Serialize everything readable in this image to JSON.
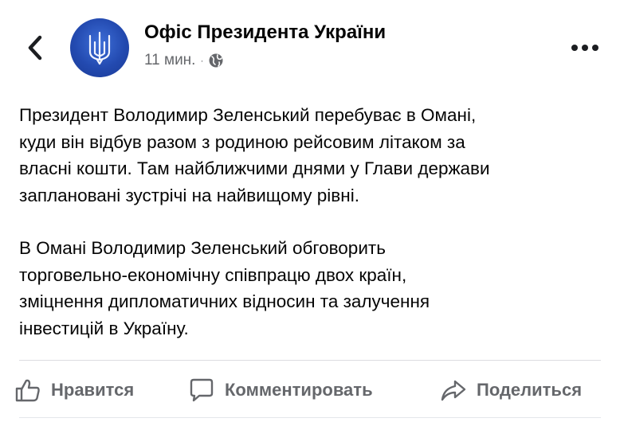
{
  "header": {
    "page_name": "Офіс Президента України",
    "time": "11 мин.",
    "separator": "·",
    "icons": {
      "back": "chevron-left-icon",
      "avatar": "ukraine-trident-emblem",
      "privacy": "globe-icon",
      "more": "more-horizontal-icon"
    }
  },
  "post": {
    "paragraphs": [
      "Президент Володимир Зеленський перебуває в Омані,\nкуди він відбув разом з родиною рейсовим літаком за\nвласні кошти. Там найближчими днями у Глави держави\nзаплановані зустрічі на найвищому рівні.",
      "В Омані Володимир Зеленський обговорить\nторговельно-економічну співпрацю двох країн,\nзміцнення дипломатичних відносин та залучення\nінвестицій в Україну."
    ]
  },
  "actions": {
    "like": {
      "label": "Нравится",
      "icon": "thumbs-up-icon"
    },
    "comment": {
      "label": "Комментировать",
      "icon": "comment-icon"
    },
    "share": {
      "label": "Поделиться",
      "icon": "share-icon"
    }
  },
  "colors": {
    "text": "#050505",
    "muted": "#65676b",
    "avatar": "#234ab0",
    "divider": "#dcdde1"
  }
}
